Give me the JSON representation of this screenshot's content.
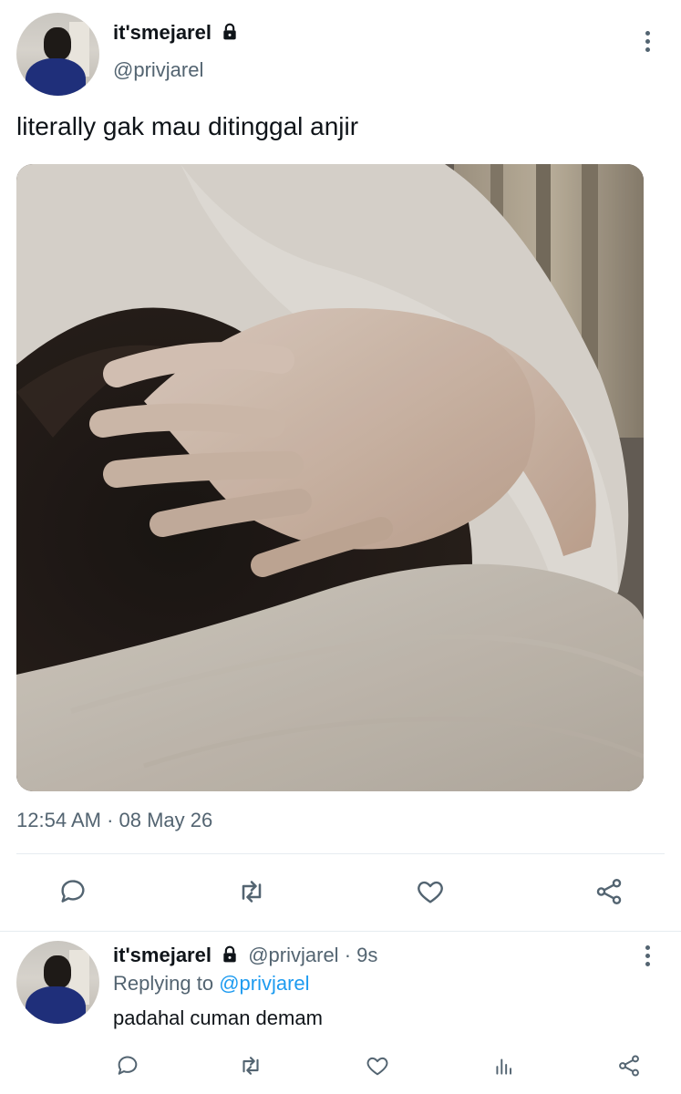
{
  "tweet": {
    "display_name": "it'smejarel",
    "handle": "@privjarel",
    "text": "literally gak mau ditinggal anjir",
    "timestamp": "12:54 AM · 08 May 26",
    "icons": {
      "lock": "lock-icon",
      "more": "more-options-icon",
      "reply": "reply-icon",
      "retweet": "retweet-icon",
      "like": "like-icon",
      "share": "share-icon"
    }
  },
  "reply": {
    "display_name": "it'smejarel",
    "handle": "@privjarel",
    "time": "· 9s",
    "replying_prefix": "Replying to",
    "replying_to": "@privjarel",
    "text": "padahal cuman demam",
    "icons": {
      "reply": "reply-icon",
      "retweet": "retweet-icon",
      "like": "like-icon",
      "analytics": "analytics-icon",
      "share": "share-icon"
    }
  },
  "colors": {
    "text": "#0f1419",
    "muted": "#536471",
    "link": "#1d9bf0",
    "divider": "#e6ecf0"
  }
}
